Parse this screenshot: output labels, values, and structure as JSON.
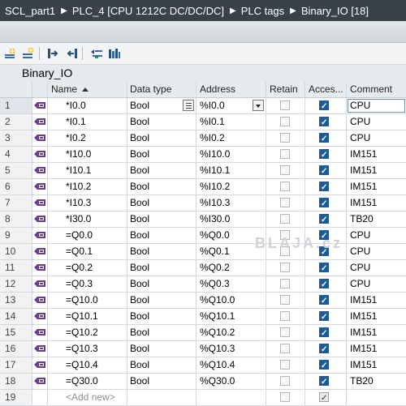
{
  "breadcrumb": [
    "SCL_part1",
    "PLC_4 [CPU 1212C DC/DC/DC]",
    "PLC tags",
    "Binary_IO [18]"
  ],
  "toolbar": {
    "icons": [
      "add-row-icon",
      "insert-row-icon",
      "export-icon",
      "import-icon",
      "monitor-icon",
      "show-all-icon"
    ]
  },
  "table_title": "Binary_IO",
  "columns": {
    "name": "Name",
    "data_type": "Data type",
    "address": "Address",
    "retain": "Retain",
    "accessible": "Acces...",
    "comment": "Comment"
  },
  "rows": [
    {
      "num": "1",
      "name": "*I0.0",
      "type": "Bool",
      "addr": "%I0.0",
      "retain": false,
      "acc": true,
      "comment": "CPU"
    },
    {
      "num": "2",
      "name": "*I0.1",
      "type": "Bool",
      "addr": "%I0.1",
      "retain": false,
      "acc": true,
      "comment": "CPU"
    },
    {
      "num": "3",
      "name": "*I0.2",
      "type": "Bool",
      "addr": "%I0.2",
      "retain": false,
      "acc": true,
      "comment": "CPU"
    },
    {
      "num": "4",
      "name": "*I10.0",
      "type": "Bool",
      "addr": "%I10.0",
      "retain": false,
      "acc": true,
      "comment": "IM151"
    },
    {
      "num": "5",
      "name": "*I10.1",
      "type": "Bool",
      "addr": "%I10.1",
      "retain": false,
      "acc": true,
      "comment": "IM151"
    },
    {
      "num": "6",
      "name": "*I10.2",
      "type": "Bool",
      "addr": "%I10.2",
      "retain": false,
      "acc": true,
      "comment": "IM151"
    },
    {
      "num": "7",
      "name": "*I10.3",
      "type": "Bool",
      "addr": "%I10.3",
      "retain": false,
      "acc": true,
      "comment": "IM151"
    },
    {
      "num": "8",
      "name": "*I30.0",
      "type": "Bool",
      "addr": "%I30.0",
      "retain": false,
      "acc": true,
      "comment": "TB20"
    },
    {
      "num": "9",
      "name": "=Q0.0",
      "type": "Bool",
      "addr": "%Q0.0",
      "retain": false,
      "acc": true,
      "comment": "CPU"
    },
    {
      "num": "10",
      "name": "=Q0.1",
      "type": "Bool",
      "addr": "%Q0.1",
      "retain": false,
      "acc": true,
      "comment": "CPU"
    },
    {
      "num": "11",
      "name": "=Q0.2",
      "type": "Bool",
      "addr": "%Q0.2",
      "retain": false,
      "acc": true,
      "comment": "CPU"
    },
    {
      "num": "12",
      "name": "=Q0.3",
      "type": "Bool",
      "addr": "%Q0.3",
      "retain": false,
      "acc": true,
      "comment": "CPU"
    },
    {
      "num": "13",
      "name": "=Q10.0",
      "type": "Bool",
      "addr": "%Q10.0",
      "retain": false,
      "acc": true,
      "comment": "IM151"
    },
    {
      "num": "14",
      "name": "=Q10.1",
      "type": "Bool",
      "addr": "%Q10.1",
      "retain": false,
      "acc": true,
      "comment": "IM151"
    },
    {
      "num": "15",
      "name": "=Q10.2",
      "type": "Bool",
      "addr": "%Q10.2",
      "retain": false,
      "acc": true,
      "comment": "IM151"
    },
    {
      "num": "16",
      "name": "=Q10.3",
      "type": "Bool",
      "addr": "%Q10.3",
      "retain": false,
      "acc": true,
      "comment": "IM151"
    },
    {
      "num": "17",
      "name": "=Q10.4",
      "type": "Bool",
      "addr": "%Q10.4",
      "retain": false,
      "acc": true,
      "comment": "IM151"
    },
    {
      "num": "18",
      "name": "=Q30.0",
      "type": "Bool",
      "addr": "%Q30.0",
      "retain": false,
      "acc": true,
      "comment": "TB20"
    }
  ],
  "new_row": {
    "num": "19",
    "placeholder": "<Add new>",
    "retain": false,
    "acc": true
  },
  "watermark": "BLAJA.cz",
  "colors": {
    "header_bg": "#39414a",
    "check_on": "#1e5a99",
    "tag_icon": "#6a3a8e"
  }
}
